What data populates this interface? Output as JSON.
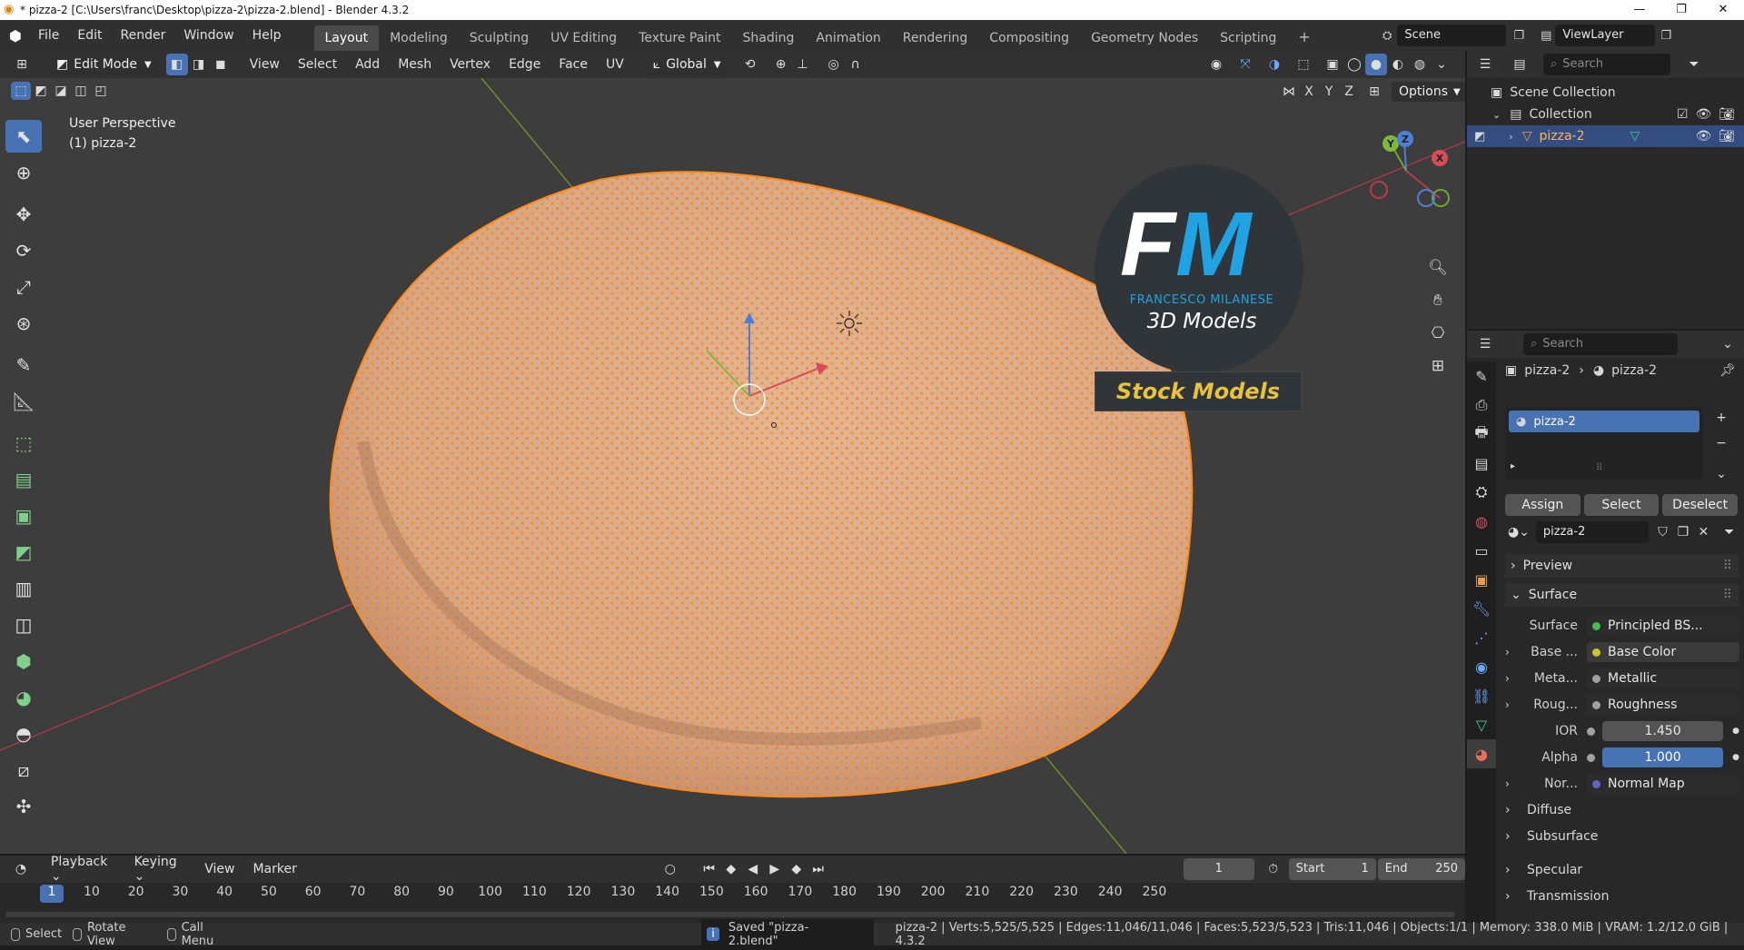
{
  "window": {
    "title": "* pizza-2 [C:\\Users\\franc\\Desktop\\pizza-2\\pizza-2.blend] - Blender 4.3.2",
    "controls": [
      "—",
      "❐",
      "✕"
    ]
  },
  "menu": [
    "File",
    "Edit",
    "Render",
    "Window",
    "Help"
  ],
  "workspaces": [
    "Layout",
    "Modeling",
    "Sculpting",
    "UV Editing",
    "Texture Paint",
    "Shading",
    "Animation",
    "Rendering",
    "Compositing",
    "Geometry Nodes",
    "Scripting"
  ],
  "active_workspace": "Layout",
  "scene": "Scene",
  "view_layer": "ViewLayer",
  "viewport": {
    "mode": "Edit Mode",
    "menus": [
      "View",
      "Select",
      "Add",
      "Mesh",
      "Vertex",
      "Edge",
      "Face",
      "UV"
    ],
    "transform_orientation": "Global",
    "axes": [
      "X",
      "Y",
      "Z"
    ],
    "options_label": "Options",
    "perspective": "User Perspective",
    "object_label": "(1) pizza-2",
    "watermark": {
      "initials_f": "F",
      "initials_m": "M",
      "name": "FRANCESCO MILANESE",
      "subtitle": "3D Models",
      "banner": "Stock Models"
    },
    "gizmo": {
      "x": "X",
      "y": "Y",
      "z": "Z"
    }
  },
  "outliner": {
    "search_placeholder": "Search",
    "scene_collection": "Scene Collection",
    "collection": "Collection",
    "object": "pizza-2"
  },
  "properties": {
    "search_placeholder": "Search",
    "breadcrumb_object": "pizza-2",
    "breadcrumb_material": "pizza-2",
    "slot": "pizza-2",
    "buttons": {
      "assign": "Assign",
      "select": "Select",
      "deselect": "Deselect"
    },
    "material_name": "pizza-2",
    "panels": {
      "preview": "Preview",
      "surface": "Surface"
    },
    "surface_rows": [
      {
        "label": "Surface",
        "value": "Principled BS...",
        "dot": "#3fbf4f"
      },
      {
        "label": "Base ...",
        "value": "Base Color",
        "dot": "#c7c729"
      },
      {
        "label": "Meta...",
        "value": "Metallic",
        "dot": "#a1a1a1"
      },
      {
        "label": "Roug...",
        "value": "Roughness",
        "dot": "#a1a1a1"
      },
      {
        "label": "IOR",
        "value": "1.450",
        "dot": "#a1a1a1"
      },
      {
        "label": "Alpha",
        "value": "1.000",
        "dot": "#a1a1a1"
      },
      {
        "label": "Nor...",
        "value": "Normal Map",
        "dot": "#6363c7"
      }
    ],
    "subpanels": [
      "Diffuse",
      "Subsurface",
      "Specular",
      "Transmission"
    ]
  },
  "timeline": {
    "menus": [
      "Playback",
      "Keying",
      "View",
      "Marker"
    ],
    "current_frame": "1",
    "start_label": "Start",
    "start": "1",
    "end_label": "End",
    "end": "250",
    "ticks": [
      "1",
      "10",
      "20",
      "30",
      "40",
      "50",
      "60",
      "70",
      "80",
      "90",
      "100",
      "110",
      "120",
      "130",
      "140",
      "150",
      "160",
      "170",
      "180",
      "190",
      "200",
      "210",
      "220",
      "230",
      "240",
      "250"
    ]
  },
  "statusbar": {
    "select": "Select",
    "rotate": "Rotate View",
    "call_menu": "Call Menu",
    "message": "Saved \"pizza-2.blend\"",
    "stats": "pizza-2 | Verts:5,525/5,525 | Edges:11,046/11,046 | Faces:5,523/5,523 | Tris:11,046 | Objects:1/1 | Memory: 338.0 MiB | VRAM: 1.2/12.0 GiB | 4.3.2"
  },
  "colors": {
    "accent": "#4772b3",
    "selection_orange": "#ff8a1c",
    "viewport_bg": "#3d3d3d"
  }
}
